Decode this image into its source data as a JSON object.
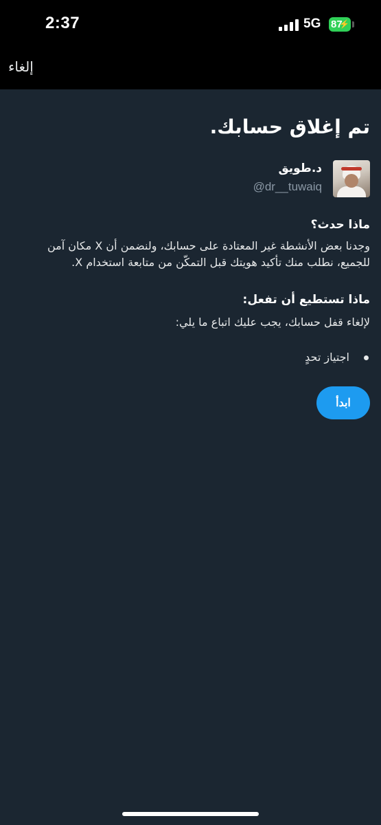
{
  "status_bar": {
    "time": "2:37",
    "network": "5G",
    "battery": "87",
    "icons": [
      "signal-bars-icon",
      "battery-charging-icon"
    ]
  },
  "nav": {
    "cancel_label": "إلغاء"
  },
  "main": {
    "title": "تم إغلاق حسابك.",
    "profile": {
      "display_name": "د.طويق",
      "handle": "@dr__tuwaiq"
    },
    "what_happened": {
      "heading": "ماذا حدث؟",
      "body": "وجدنا بعض الأنشطة غير المعتادة على حسابك، ولنضمن أن X مكان آمن للجميع، نطلب منك تأكيد هويتك قبل التمكّن من متابعة استخدام X."
    },
    "what_you_can_do": {
      "heading": "ماذا تستطيع أن تفعل:",
      "body": "لإلغاء قفل حسابك، يجب عليك اتباع ما يلي:",
      "items": [
        "اجتياز تحدٍ"
      ]
    },
    "start_label": "ابدأ"
  },
  "colors": {
    "background": "#1b2631",
    "bar_background": "#000000",
    "accent": "#1d9bf0",
    "battery": "#30d158",
    "secondary_text": "#8b98a5"
  }
}
